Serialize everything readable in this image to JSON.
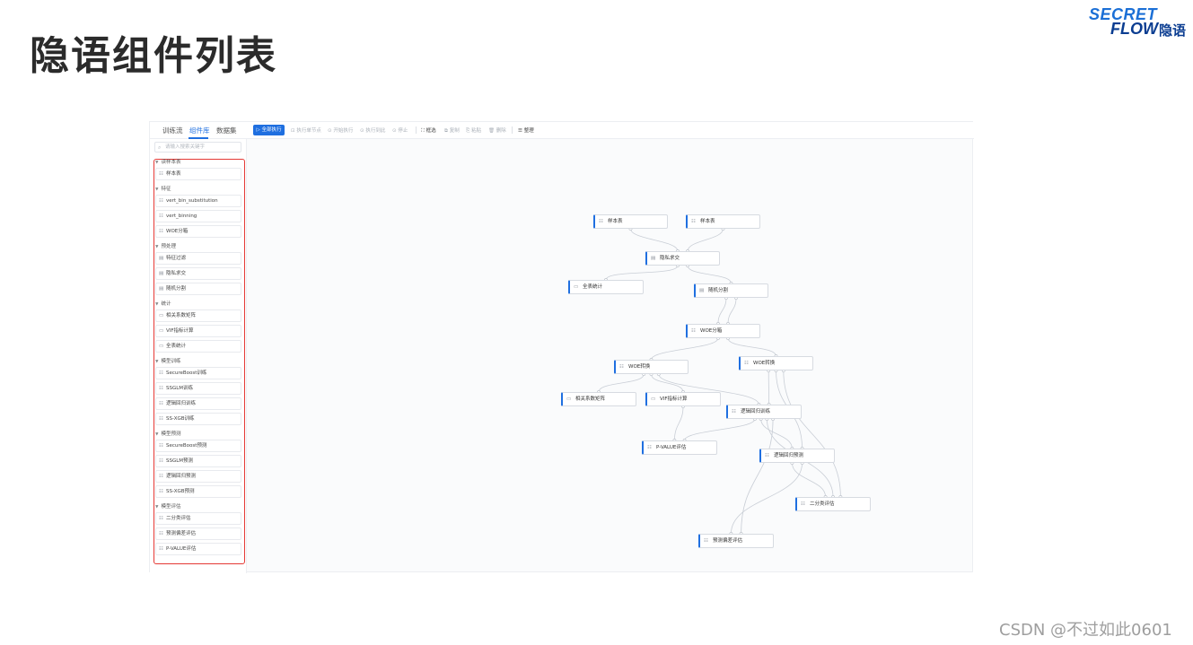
{
  "slide": {
    "title": "隐语组件列表",
    "logo_line1": "SECRET",
    "logo_line2": "FLOW",
    "logo_line3": "隐语",
    "watermark": "CSDN @不过如此0601"
  },
  "app": {
    "tabs": [
      {
        "label": "训练流",
        "active": false
      },
      {
        "label": "组件库",
        "active": true
      },
      {
        "label": "数据集",
        "active": false
      }
    ],
    "toolbar": {
      "run_all": "全部执行",
      "run_single": "执行单节点",
      "run_from": "开始执行",
      "run_to": "执行到此",
      "stop": "停止",
      "select": "框选",
      "copy": "复制",
      "paste": "粘贴",
      "delete": "删除",
      "arrange": "整理"
    },
    "search": {
      "placeholder": "请输入搜索关键字"
    },
    "sidebar": [
      {
        "category": "读样本表",
        "items": [
          "样本表"
        ]
      },
      {
        "category": "特征",
        "items": [
          "vert_bin_substitution",
          "vert_binning",
          "WOE分箱"
        ]
      },
      {
        "category": "预处理",
        "items": [
          "特征过滤",
          "隐私求交",
          "随机分割"
        ]
      },
      {
        "category": "统计",
        "items": [
          "相关系数矩阵",
          "VIF指标计算",
          "全表统计"
        ]
      },
      {
        "category": "模型训练",
        "items": [
          "SecureBoost训练",
          "SSGLM训练",
          "逻辑回归训练",
          "SS-XGB训练"
        ]
      },
      {
        "category": "模型预测",
        "items": [
          "SecureBoost预测",
          "SSGLM预测",
          "逻辑回归预测",
          "SS-XGB预测"
        ]
      },
      {
        "category": "模型评估",
        "items": [
          "二分类评估",
          "预测偏差评估",
          "P-VALUE评估"
        ]
      }
    ],
    "graph_nodes": [
      {
        "id": "n1",
        "label": "样本表"
      },
      {
        "id": "n2",
        "label": "样本表"
      },
      {
        "id": "n3",
        "label": "隐私求交"
      },
      {
        "id": "n4",
        "label": "全表统计"
      },
      {
        "id": "n5",
        "label": "随机分割"
      },
      {
        "id": "n6",
        "label": "WOE分箱"
      },
      {
        "id": "n7",
        "label": "WOE转换"
      },
      {
        "id": "n8",
        "label": "WOE转换"
      },
      {
        "id": "n9",
        "label": "相关系数矩阵"
      },
      {
        "id": "n10",
        "label": "VIF指标计算"
      },
      {
        "id": "n11",
        "label": "逻辑回归训练"
      },
      {
        "id": "n12",
        "label": "P-VALUE评估"
      },
      {
        "id": "n13",
        "label": "逻辑回归预测"
      },
      {
        "id": "n14",
        "label": "二分类评估"
      },
      {
        "id": "n15",
        "label": "预测偏差评估"
      }
    ],
    "graph_edges": [
      [
        "n1",
        "n3"
      ],
      [
        "n2",
        "n3"
      ],
      [
        "n3",
        "n4"
      ],
      [
        "n3",
        "n5"
      ],
      [
        "n5",
        "n6"
      ],
      [
        "n5",
        "n6"
      ],
      [
        "n6",
        "n7"
      ],
      [
        "n6",
        "n8"
      ],
      [
        "n7",
        "n9"
      ],
      [
        "n7",
        "n10"
      ],
      [
        "n7",
        "n11"
      ],
      [
        "n8",
        "n11"
      ],
      [
        "n10",
        "n12"
      ],
      [
        "n11",
        "n12"
      ],
      [
        "n11",
        "n13"
      ],
      [
        "n8",
        "n13"
      ],
      [
        "n13",
        "n14"
      ],
      [
        "n11",
        "n14"
      ],
      [
        "n8",
        "n14"
      ],
      [
        "n13",
        "n15"
      ],
      [
        "n11",
        "n15"
      ]
    ]
  }
}
